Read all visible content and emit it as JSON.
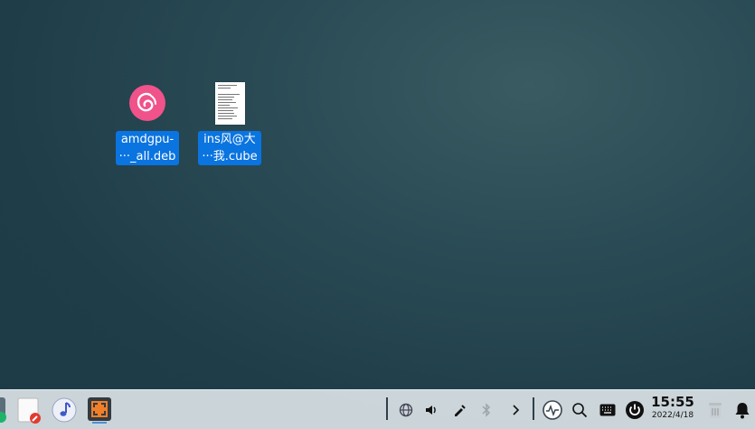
{
  "desktop": {
    "icons": [
      {
        "name": "amdgpu-deb",
        "line1": "amdgpu-",
        "line2": "···_all.deb",
        "icon": "debian-swirl-icon"
      },
      {
        "name": "ins-cube",
        "line1": "ins风@大",
        "line2": "···我.cube",
        "icon": "text-document-icon"
      }
    ]
  },
  "taskbar": {
    "apps": [
      {
        "name": "app-store",
        "icon": "app-store-icon"
      },
      {
        "name": "notes",
        "icon": "notes-icon"
      },
      {
        "name": "music",
        "icon": "music-note-icon"
      },
      {
        "name": "screenshot",
        "icon": "screen-capture-icon"
      }
    ],
    "tray": [
      "network-icon",
      "volume-icon",
      "pen-icon",
      "bluetooth-icon",
      "chevron-right-icon",
      "system-monitor-icon",
      "search-icon",
      "keyboard-icon",
      "power-icon"
    ],
    "clock": {
      "time": "15:55",
      "date": "2022/4/18"
    },
    "trash_icon": "trash-icon",
    "notification_icon": "bell-icon"
  },
  "colors": {
    "selection": "#0a74e0",
    "debian": "#f0528a",
    "taskbar": "#dae2e6",
    "accent_orange": "#f07f2a"
  }
}
